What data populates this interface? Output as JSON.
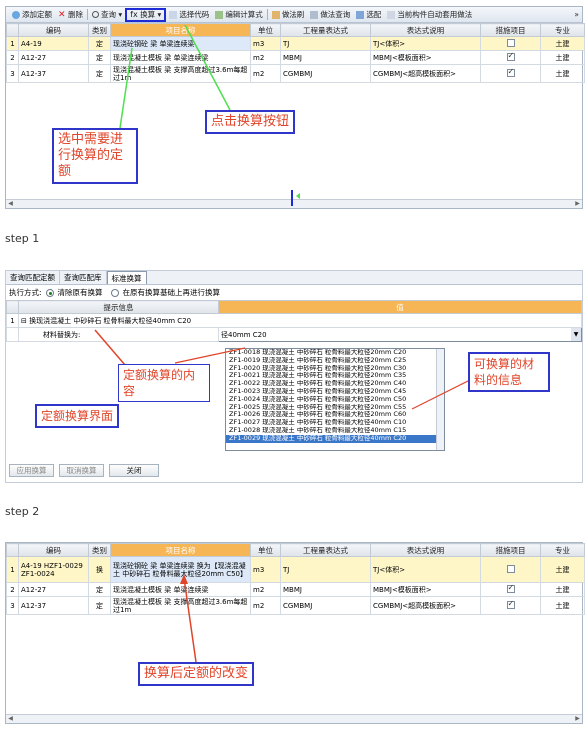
{
  "toolbar": {
    "items": [
      {
        "label": "添加定额",
        "icon": "add-icon"
      },
      {
        "label": "删除",
        "icon": "delete-icon"
      },
      {
        "label": "查询 ▾",
        "icon": "search-icon"
      },
      {
        "label": "换算 ▾",
        "icon": "convert-icon"
      },
      {
        "label": "选择代码",
        "icon": "select-code-icon"
      },
      {
        "label": "编辑计算式",
        "icon": "edit-formula-icon"
      },
      {
        "label": "做法刷",
        "icon": "brush-icon"
      },
      {
        "label": "做法查询",
        "icon": "method-query-icon"
      },
      {
        "label": "选配",
        "icon": "match-icon"
      },
      {
        "label": "当前构件自动套用做法",
        "icon": "auto-apply-icon"
      }
    ],
    "more": "»"
  },
  "grid_headers": [
    "",
    "编码",
    "类别",
    "项目名称",
    "单位",
    "工程量表达式",
    "表达式说明",
    "措施项目",
    "专业"
  ],
  "grid1_rows": [
    {
      "num": "1",
      "code": "A4-19",
      "type": "定",
      "name": "现浇砼钢砼 梁 单梁连续梁",
      "unit": "m3",
      "expr": "TJ",
      "desc": "TJ<体积>",
      "measure": false,
      "pro": "土建"
    },
    {
      "num": "2",
      "code": "A12-27",
      "type": "定",
      "name": "现浇混凝土模板 梁 单梁连续梁",
      "unit": "m2",
      "expr": "MBMJ",
      "desc": "MBMJ<模板面积>",
      "measure": true,
      "pro": "土建"
    },
    {
      "num": "3",
      "code": "A12-37",
      "type": "定",
      "name": "现浇混凝土模板 梁 支撑高度超过3.6m每超过1m",
      "unit": "m2",
      "expr": "CGMBMJ",
      "desc": "CGMBMJ<超高模板面积>",
      "measure": true,
      "pro": "土建"
    }
  ],
  "annotations": {
    "select_quota": "选中需要进行换算的定额",
    "click_convert": "点击换算按钮",
    "convert_content": "定额换算的内容",
    "convertible_material": "可换算的材料的信息",
    "convert_ui": "定额换算界面",
    "after_change": "换算后定额的改变"
  },
  "steps": {
    "step1": "step 1",
    "step2": "step 2"
  },
  "panel2": {
    "tabs": [
      "查询匹配定额",
      "查询匹配库",
      "标准换算"
    ],
    "mode_label": "执行方式:",
    "mode_option1": "清除原有换算",
    "mode_option2": "在原有换算基础上再进行换算",
    "col_hint": "提示信息",
    "col_value": "值",
    "row1_num": "1",
    "row1_text": "⊟ 换现浇混凝土 中砂碎石 粒骨料最大粒径40mm C20",
    "row2_text": "材料替换为:",
    "combo_value": "径40mm C20",
    "materials": [
      "ZF1-0018  现浇混凝土 中砂碎石 粒骨料最大粒径20mm C20",
      "ZF1-0019  现浇混凝土 中砂碎石 粒骨料最大粒径20mm C25",
      "ZF1-0020  现浇混凝土 中砂碎石 粒骨料最大粒径20mm C30",
      "ZF1-0021  现浇混凝土 中砂碎石 粒骨料最大粒径20mm C35",
      "ZF1-0022  现浇混凝土 中砂碎石 粒骨料最大粒径20mm C40",
      "ZF1-0023  现浇混凝土 中砂碎石 粒骨料最大粒径20mm C45",
      "ZF1-0024  现浇混凝土 中砂碎石 粒骨料最大粒径20mm C50",
      "ZF1-0025  现浇混凝土 中砂碎石 粒骨料最大粒径20mm C55",
      "ZF1-0026  现浇混凝土 中砂碎石 粒骨料最大粒径20mm C60",
      "ZF1-0027  现浇混凝土 中砂碎石 粒骨料最大粒径40mm C10",
      "ZF1-0028  现浇混凝土 中砂碎石 粒骨料最大粒径40mm C15",
      "ZF1-0029  现浇混凝土 中砂碎石 粒骨料最大粒径40mm C20"
    ],
    "selected_index": 11,
    "buttons": [
      "应用换算",
      "取消换算",
      "关闭"
    ]
  },
  "grid3_rows": [
    {
      "num": "1",
      "code": "A4-19 HZF1-0029 ZF1-0024",
      "type": "换",
      "name": "现浇砼钢砼 梁 单梁连续梁 换为【现浇混凝土 中砂碎石 粒骨料最大粒径20mm C50】",
      "unit": "m3",
      "expr": "TJ",
      "desc": "TJ<体积>",
      "measure": false,
      "pro": "土建"
    },
    {
      "num": "2",
      "code": "A12-27",
      "type": "定",
      "name": "现浇混凝土模板 梁 单梁连续梁",
      "unit": "m2",
      "expr": "MBMJ",
      "desc": "MBMJ<模板面积>",
      "measure": true,
      "pro": "土建"
    },
    {
      "num": "3",
      "code": "A12-37",
      "type": "定",
      "name": "现浇混凝土模板 梁 支撑高度超过3.6m每超过1m",
      "unit": "m2",
      "expr": "CGMBMJ",
      "desc": "CGMBMJ<超高模板面积>",
      "measure": true,
      "pro": "土建"
    }
  ]
}
